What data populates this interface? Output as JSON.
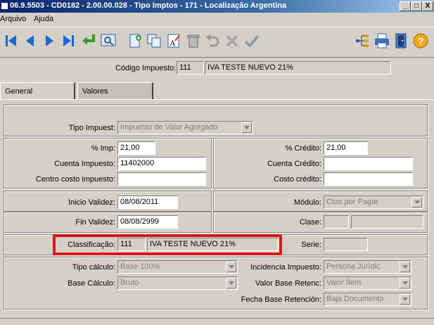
{
  "window": {
    "title": "06.9.5503 - CD0182 - 2.00.00.028 - Tipo Imptos - 171 - Localização Argentina",
    "minimize": "_",
    "maximize": "□",
    "close": "X"
  },
  "menu": [
    "Arquivo",
    "Ajuda"
  ],
  "toolbar": {
    "buttons": [
      "first-icon",
      "previous-icon",
      "next-icon",
      "last-icon",
      "return-icon",
      "search-icon",
      "new-icon",
      "copy-icon",
      "edit-icon",
      "delete-icon",
      "undo-icon",
      "cancel-icon",
      "confirm-icon",
      "tree-icon",
      "print-icon",
      "exit-icon",
      "help-icon"
    ]
  },
  "header": {
    "codigo_label": "Código Impuesto:",
    "codigo_value": "111",
    "descricao_value": "IVA TESTE NUEVO 21%"
  },
  "tabs": [
    "General",
    "Valores"
  ],
  "form": {
    "tipo_impuest_label": "Tipo Impuest:",
    "tipo_impuest_value": "Impuesto de Valor Agregado",
    "pct_imp_label": "% Imp:",
    "pct_imp_value": "21,00",
    "cuenta_impuesto_label": "Cuenta Impuesto:",
    "cuenta_impuesto_value": "11402000",
    "centro_costo_label": "Centro costo impuesto:",
    "centro_costo_value": "",
    "pct_credito_label": "% Crédito:",
    "pct_credito_value": "21,00",
    "cuenta_credito_label": "Cuenta Crédito:",
    "cuenta_credito_value": "",
    "costo_credito_label": "Costo crédito:",
    "costo_credito_value": "",
    "inicio_validez_label": "Inicio Validez:",
    "inicio_validez_value": "08/08/2011",
    "fin_validez_label": "Fin Validez:",
    "fin_validez_value": "08/08/2999",
    "modulo_label": "Módulo:",
    "modulo_value": "Ctas por Pagar",
    "clase_label": "Clase:",
    "clase_value1": "",
    "clase_value2": "",
    "classificacao_label": "Classificação:",
    "classificacao_code": "111",
    "classificacao_desc": "IVA TESTE NUEVO 21%",
    "serie_label": "Serie:",
    "serie_value": "",
    "tipo_calculo_label": "Tipo cálculo:",
    "tipo_calculo_value": "Base 100%",
    "base_calculo_label": "Base Cálculo:",
    "base_calculo_value": "Bruto",
    "incidencia_label": "Incidencia Impuesto:",
    "incidencia_value": "Persona Jurídic",
    "valor_base_label": "Valor Base Retenc:",
    "valor_base_value": "Valor Ítem",
    "fecha_base_label": "Fecha Base Retención:",
    "fecha_base_value": "Baja Documento"
  },
  "colors": {
    "highlight": "#d81919",
    "titlebar": "#0a246a",
    "face": "#d4d0c8"
  }
}
